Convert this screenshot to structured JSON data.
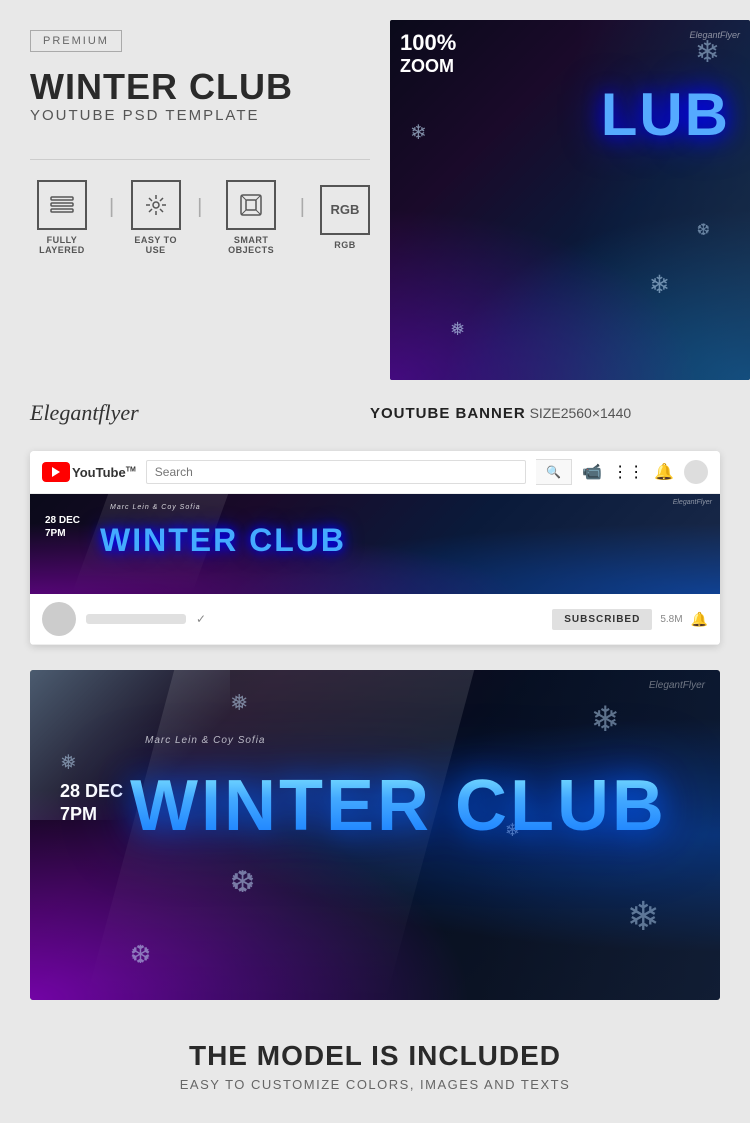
{
  "badge": {
    "label": "PREMIUM"
  },
  "header": {
    "title": "WINTER CLUB",
    "subtitle": "YOUTUBE PSD TEMPLATE"
  },
  "features": [
    {
      "icon": "layers",
      "label": "FULLY LAYERED"
    },
    {
      "icon": "wand",
      "label": "EASY TO USE"
    },
    {
      "icon": "smartobj",
      "label": "SMART OBJECTS"
    },
    {
      "icon": "rgb",
      "label": "RGB"
    }
  ],
  "branding": {
    "logo": "Elegantflyer",
    "watermark": "ElegantFlyer"
  },
  "banner_info": {
    "title": "YOUTUBE BANNER",
    "size": "SIZE2560×1440"
  },
  "zoom": {
    "label": "100%\nZOOM"
  },
  "youtube": {
    "search_placeholder": "Search",
    "subscribed_label": "SUBSCRIBED",
    "sub_count": "5.8M",
    "channel_verified": "✓"
  },
  "event": {
    "date": "28 DEC",
    "time": "7PM",
    "title": "WINTER CLUB",
    "subtitle_small": "Marc Lein & Coy Sofia"
  },
  "bottom": {
    "title": "THE MODEL IS INCLUDED",
    "subtitle": "EASY TO CUSTOMIZE COLORS, IMAGES AND TEXTS"
  }
}
